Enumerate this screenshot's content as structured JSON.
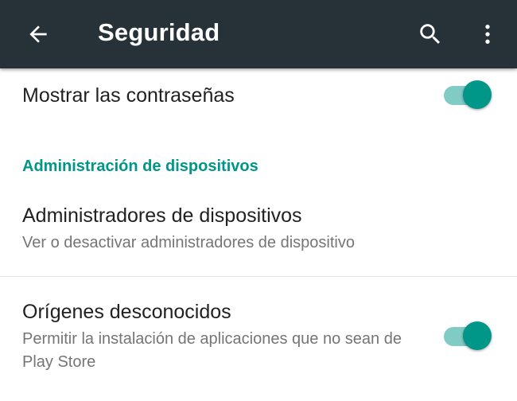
{
  "toolbar": {
    "title": "Seguridad",
    "back_icon": "arrow-back-icon",
    "search_icon": "search-icon",
    "more_icon": "more-vert-icon",
    "background_color": "#263238"
  },
  "settings": {
    "show_passwords": {
      "label": "Mostrar las contraseñas",
      "enabled": true
    },
    "section_header": "Administración de dispositivos",
    "device_admins": {
      "label": "Administradores de dispositivos",
      "summary": "Ver o desactivar administradores de dispositivo"
    },
    "unknown_sources": {
      "label": "Orígenes desconocidos",
      "summary": "Permitir la instalación de aplicaciones que no sean de Play Store",
      "enabled": true
    }
  },
  "colors": {
    "accent": "#009688",
    "switch_track": "#80CBC4",
    "primary_text": "#212121",
    "secondary_text": "#757575"
  }
}
